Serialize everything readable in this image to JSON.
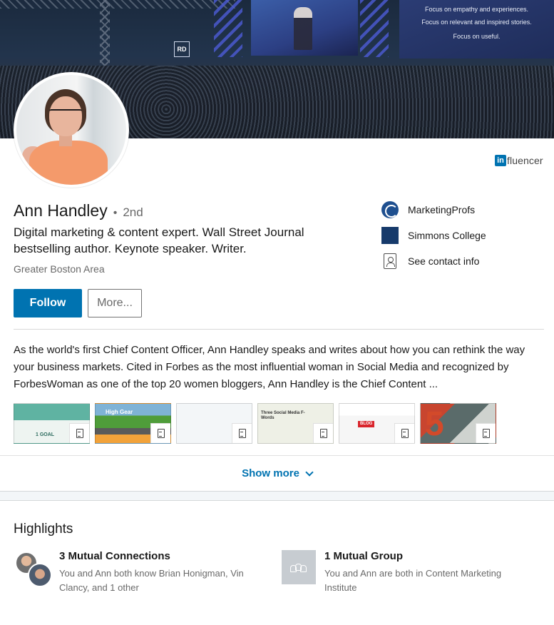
{
  "banner": {
    "screen_lines": [
      "Focus on empathy and experiences.",
      "Focus on relevant and inspired stories.",
      "Focus on useful."
    ],
    "logo_text": "RD"
  },
  "influencer": {
    "in": "in",
    "rest": "fluencer"
  },
  "profile": {
    "name": "Ann Handley",
    "degree_dot": "•",
    "degree": "2nd",
    "headline": "Digital marketing & content expert. Wall Street Journal bestselling author. Keynote speaker. Writer.",
    "location": "Greater Boston Area"
  },
  "actions": {
    "follow": "Follow",
    "more": "More..."
  },
  "info": [
    {
      "label": "MarketingProfs",
      "icon": "marketingprofs-logo-icon"
    },
    {
      "label": "Simmons College",
      "icon": "simmons-college-logo-icon"
    },
    {
      "label": "See contact info",
      "icon": "contact-card-icon"
    }
  ],
  "summary": "As the world's first Chief Content Officer, Ann Handley speaks and writes about how you can rethink the way your business markets. Cited in Forbes as the most influential woman in Social Media and recognized by ForbesWoman as one of the top 20 women bloggers, Ann Handley is the Chief Content ...",
  "media": [
    {
      "icon": "document-icon",
      "caption": "1 GOAL"
    },
    {
      "icon": "document-icon",
      "caption": "High Gear"
    },
    {
      "icon": "document-icon",
      "caption": ""
    },
    {
      "icon": "document-icon",
      "caption": "Three Social Media F-Words"
    },
    {
      "icon": "document-icon",
      "caption": "BLOG"
    },
    {
      "icon": "document-icon",
      "caption": "5"
    }
  ],
  "show_more": "Show more",
  "highlights": {
    "title": "Highlights",
    "connections": {
      "title": "3 Mutual Connections",
      "desc": "You and Ann both know Brian Honigman, Vin Clancy, and 1 other"
    },
    "group": {
      "title": "1 Mutual Group",
      "desc": "You and Ann are both in Content Marketing Institute"
    }
  },
  "colors": {
    "accent": "#0073b1",
    "divider": "#e6e9ec"
  }
}
